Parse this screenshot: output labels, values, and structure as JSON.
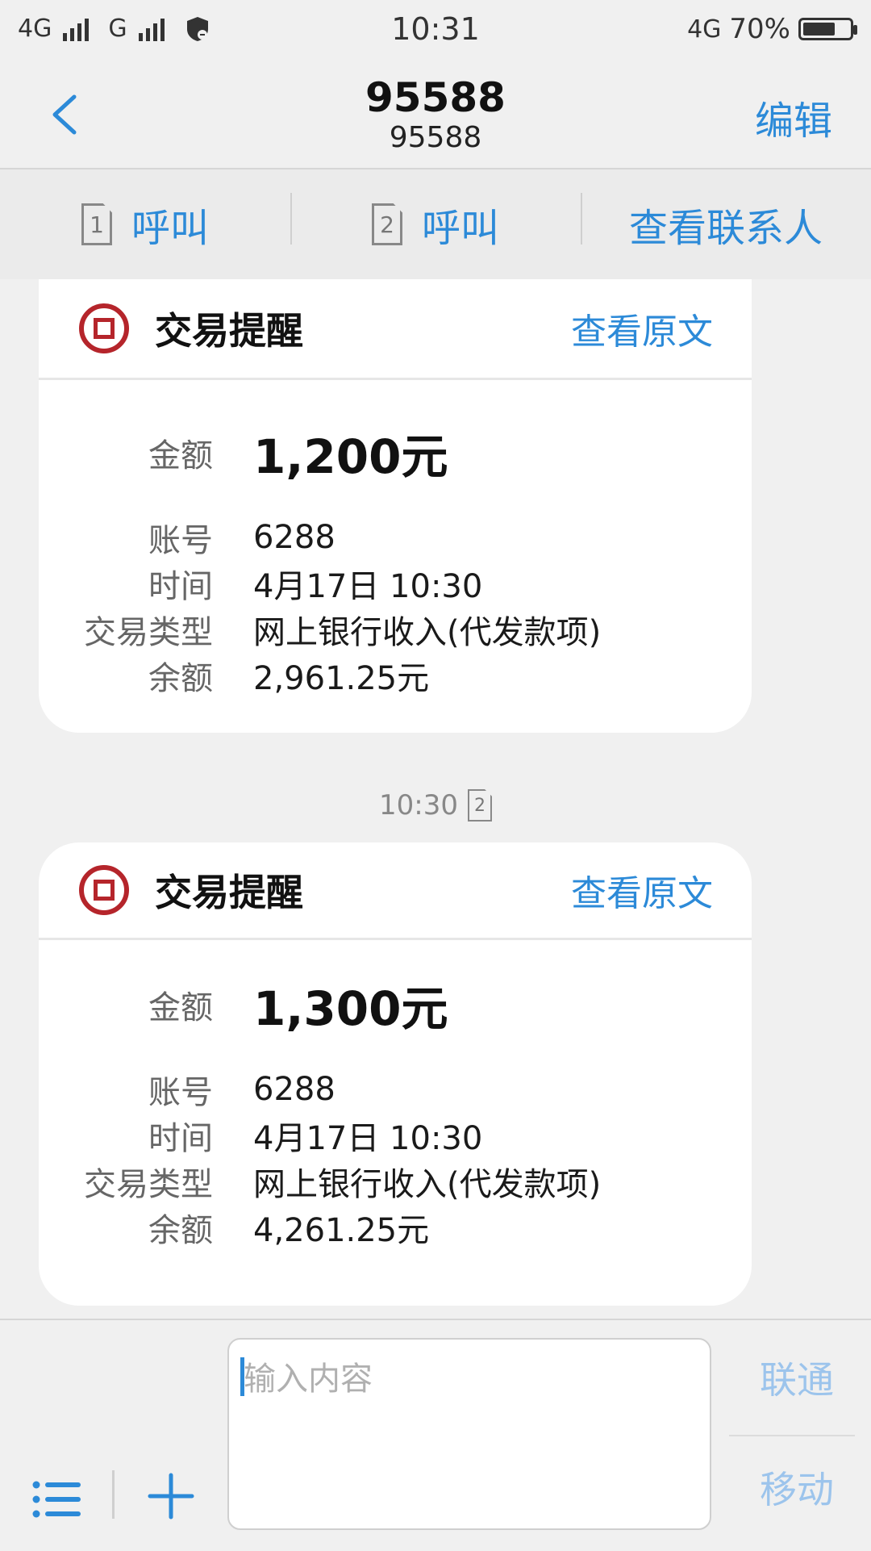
{
  "status_bar": {
    "sim1_network": "4G",
    "sim2_network": "G",
    "time": "10:31",
    "data_network": "4G",
    "battery_percent": "70%",
    "battery_level": 0.7
  },
  "header": {
    "title": "95588",
    "subtitle": "95588",
    "edit_label": "编辑"
  },
  "actions": {
    "call1_label": "呼叫",
    "call1_sim": "1",
    "call2_label": "呼叫",
    "call2_sim": "2",
    "view_contact_label": "查看联系人"
  },
  "messages": [
    {
      "title": "交易提醒",
      "view_original": "查看原文",
      "amount_label": "金额",
      "amount": "1,200元",
      "account_label": "账号",
      "account": "6288",
      "time_label": "时间",
      "time": "4月17日 10:30",
      "type_label": "交易类型",
      "type": "网上银行收入(代发款项)",
      "balance_label": "余额",
      "balance": "2,961.25元"
    },
    {
      "timestamp": "10:30",
      "timestamp_sim": "2",
      "title": "交易提醒",
      "view_original": "查看原文",
      "amount_label": "金额",
      "amount": "1,300元",
      "account_label": "账号",
      "account": "6288",
      "time_label": "时间",
      "time": "4月17日 10:30",
      "type_label": "交易类型",
      "type": "网上银行收入(代发款项)",
      "balance_label": "余额",
      "balance": "4,261.25元"
    }
  ],
  "composer": {
    "placeholder": "输入内容",
    "send_sim1_label": "联通",
    "send_sim2_label": "移动"
  },
  "colors": {
    "accent": "#2c8ad8",
    "bank_red": "#b5252b",
    "background": "#f0f0f0"
  },
  "icons": [
    "back-chevron-icon",
    "sim-card-icon",
    "bank-logo-icon",
    "menu-list-icon",
    "plus-icon",
    "shield-icon",
    "battery-icon"
  ]
}
